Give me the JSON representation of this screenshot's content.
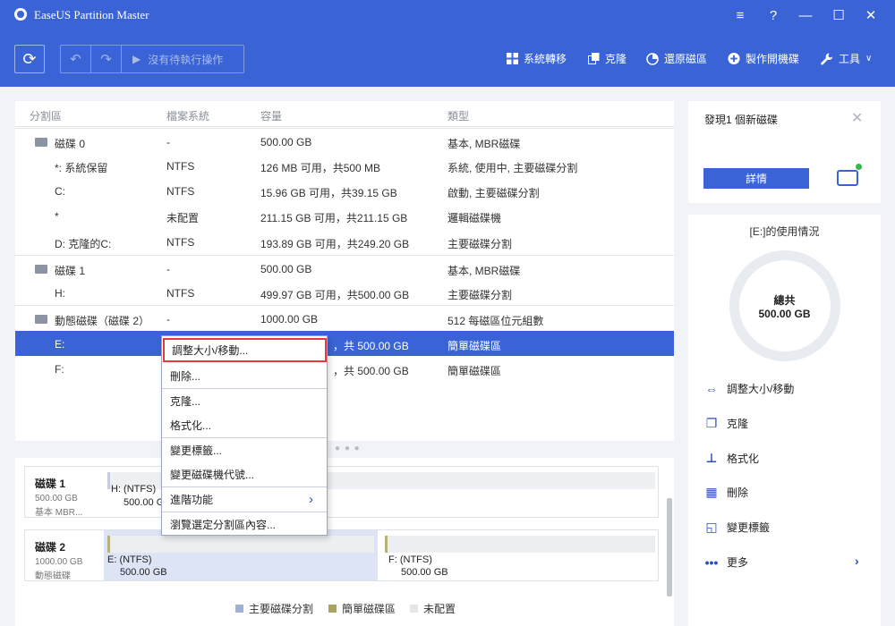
{
  "app": {
    "title": "EaseUS Partition Master"
  },
  "window": {
    "menu_icon": "≡",
    "help_icon": "?",
    "min_icon": "—",
    "max_icon": "☐",
    "close_icon": "✕"
  },
  "toolbar": {
    "refresh_icon": "⟳",
    "undo_icon": "↶",
    "redo_icon": "↷",
    "apply_icon": "▶",
    "pending_label": "沒有待執行操作",
    "migrate_label": "系統轉移",
    "clone_label": "克隆",
    "restore_label": "還原磁區",
    "bootable_label": "製作開機碟",
    "tools_label": "工具"
  },
  "table": {
    "headers": {
      "partition": "分割區",
      "filesystem": "檔案系統",
      "capacity": "容量",
      "type": "類型"
    },
    "rows": [
      {
        "name": "磁碟 0",
        "fs": "-",
        "cap": "500.00 GB",
        "type": "基本, MBR磁碟"
      },
      {
        "name": "*: 系統保留",
        "fs": "NTFS",
        "cap": "126 MB 可用，共500 MB",
        "type": "系統, 使用中, 主要磁碟分割"
      },
      {
        "name": "C:",
        "fs": "NTFS",
        "cap": "15.96 GB 可用，共39.15 GB",
        "type": "啟動, 主要磁碟分割"
      },
      {
        "name": "*",
        "fs": "未配置",
        "cap": "211.15 GB 可用，共211.15 GB",
        "type": "邏輯磁碟機"
      },
      {
        "name": "D: 克隆的C:",
        "fs": "NTFS",
        "cap": "193.89 GB 可用，共249.20 GB",
        "type": "主要磁碟分割"
      },
      {
        "name": "磁碟 1",
        "fs": "-",
        "cap": "500.00 GB",
        "type": "基本, MBR磁碟"
      },
      {
        "name": "H:",
        "fs": "NTFS",
        "cap": "499.97 GB 可用，共500.00 GB",
        "type": "主要磁碟分割"
      },
      {
        "name": "動態磁碟（磁碟 2）",
        "fs": "-",
        "cap": "1000.00 GB",
        "type": "512 每磁區位元組數"
      },
      {
        "name": "E:",
        "fs": "",
        "cap": "，共 500.00 GB",
        "type": "簡單磁碟區"
      },
      {
        "name": "F:",
        "fs": "",
        "cap": "，共 500.00 GB",
        "type": "簡單磁碟區"
      }
    ]
  },
  "context_menu": {
    "items": [
      "調整大小/移動...",
      "刪除...",
      "克隆...",
      "格式化...",
      "變更標籤...",
      "變更磁碟機代號...",
      "進階功能",
      "瀏覽選定分割區內容..."
    ],
    "submenu_arrow": "›"
  },
  "disk_map": {
    "disk1": {
      "name": "磁碟 1",
      "size": "500.00 GB",
      "kind": "基本 MBR...",
      "part_label": "H: (NTFS)",
      "part_size": "500.00 GB"
    },
    "disk2": {
      "name": "磁碟 2",
      "size": "1000.00 GB",
      "kind": "動態磁碟",
      "parts": [
        {
          "label": "E: (NTFS)",
          "size": "500.00 GB"
        },
        {
          "label": "F: (NTFS)",
          "size": "500.00 GB"
        }
      ]
    }
  },
  "legend": [
    {
      "label": "主要磁碟分割",
      "color": "#9fb1d8"
    },
    {
      "label": "簡單磁碟區",
      "color": "#a8a45e"
    },
    {
      "label": "未配置",
      "color": "#e4e6ea"
    }
  ],
  "sidebar": {
    "found_text": "發現1 個新磁碟",
    "close_icon": "✕",
    "detail_button": "詳情",
    "usage_title": "[E:]的使用情況",
    "total_label": "總共",
    "total_value": "500.00 GB",
    "actions": [
      "調整大小/移動",
      "克隆",
      "格式化",
      "刪除",
      "變更標籤",
      "更多"
    ],
    "more_arrow": "›"
  }
}
